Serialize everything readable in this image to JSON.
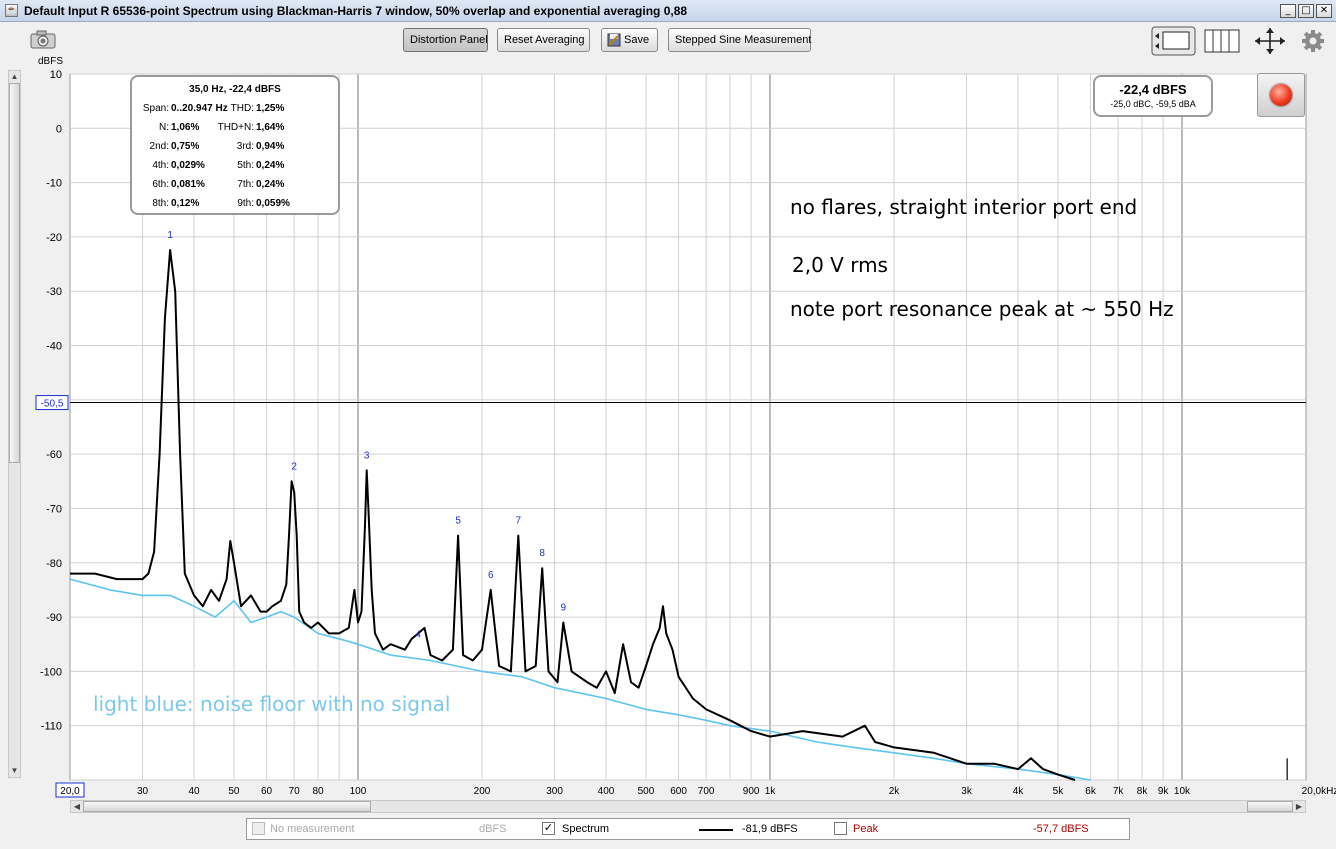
{
  "window": {
    "title": "Default Input R 65536-point Spectrum using Blackman-Harris 7 window, 50% overlap and exponential averaging 0,88",
    "minimize": "_",
    "maximize": "□",
    "close": "✕"
  },
  "toolbar": {
    "distortion_panel": "Distortion Panel",
    "reset_averaging": "Reset Averaging",
    "save": "Save",
    "stepped_sine": "Stepped Sine Measurement"
  },
  "icons": {
    "camera": "camera-icon",
    "save": "save-icon",
    "view_layout": "view-layout-icon",
    "columns": "columns-icon",
    "fit": "fit-arrows-icon",
    "settings": "gear-icon",
    "record": "record-icon"
  },
  "info_box": {
    "header": "35,0 Hz, -22,4 dBFS",
    "rows": [
      {
        "l1": "Span:",
        "v1": "0..20.947 Hz",
        "l2": "THD:",
        "v2": "1,25%"
      },
      {
        "l1": "N:",
        "v1": "1,06%",
        "l2": "THD+N:",
        "v2": "1,64%"
      },
      {
        "l1": "2nd:",
        "v1": "0,75%",
        "l2": "3rd:",
        "v2": "0,94%"
      },
      {
        "l1": "4th:",
        "v1": "0,029%",
        "l2": "5th:",
        "v2": "0,24%"
      },
      {
        "l1": "6th:",
        "v1": "0,081%",
        "l2": "7th:",
        "v2": "0,24%"
      },
      {
        "l1": "8th:",
        "v1": "0,12%",
        "l2": "9th:",
        "v2": "0,059%"
      }
    ]
  },
  "level_box": {
    "main": "-22,4 dBFS",
    "sub": "-25,0 dBC, -59,5 dBA"
  },
  "annotations": {
    "line1": "no flares, straight interior port end",
    "line2": "2,0 V rms",
    "line3": "note port resonance peak at ~ 550 Hz",
    "noise": "light blue: noise floor with no signal"
  },
  "legend": {
    "no_measurement": "No measurement",
    "no_measurement_unit": "dBFS",
    "spectrum": "Spectrum",
    "spectrum_checked": "✓",
    "spectrum_value": "-81,9 dBFS",
    "peak": "Peak",
    "peak_value": "-57,7 dBFS"
  },
  "chart_data": {
    "type": "line",
    "ylabel": "dBFS",
    "xscale": "log",
    "xlim": [
      20,
      20000
    ],
    "ylim": [
      -120,
      10
    ],
    "grid": true,
    "cursor_y": -50.5,
    "cursor_y_label": "-50,5",
    "x_start_label": "20,0",
    "x_end_label": "20,0kHz",
    "y_ticks": [
      10,
      0,
      -10,
      -20,
      -30,
      -40,
      -60,
      -70,
      -80,
      -90,
      -100,
      -110
    ],
    "x_ticks": [
      {
        "v": 30,
        "label": "30"
      },
      {
        "v": 40,
        "label": "40"
      },
      {
        "v": 50,
        "label": "50"
      },
      {
        "v": 60,
        "label": "60"
      },
      {
        "v": 70,
        "label": "70"
      },
      {
        "v": 80,
        "label": "80"
      },
      {
        "v": 100,
        "label": "100"
      },
      {
        "v": 200,
        "label": "200"
      },
      {
        "v": 300,
        "label": "300"
      },
      {
        "v": 400,
        "label": "400"
      },
      {
        "v": 500,
        "label": "500"
      },
      {
        "v": 600,
        "label": "600"
      },
      {
        "v": 700,
        "label": "700"
      },
      {
        "v": 900,
        "label": "900"
      },
      {
        "v": 1000,
        "label": "1k"
      },
      {
        "v": 2000,
        "label": "2k"
      },
      {
        "v": 3000,
        "label": "3k"
      },
      {
        "v": 4000,
        "label": "4k"
      },
      {
        "v": 5000,
        "label": "5k"
      },
      {
        "v": 6000,
        "label": "6k"
      },
      {
        "v": 7000,
        "label": "7k"
      },
      {
        "v": 8000,
        "label": "8k"
      },
      {
        "v": 9000,
        "label": "9k"
      },
      {
        "v": 10000,
        "label": "10k"
      }
    ],
    "harmonic_markers": [
      {
        "label": "1",
        "x": 35,
        "y": -22.4
      },
      {
        "label": "2",
        "x": 70,
        "y": -65
      },
      {
        "label": "3",
        "x": 105,
        "y": -63
      },
      {
        "label": "4",
        "x": 140,
        "y": -96
      },
      {
        "label": "5",
        "x": 175,
        "y": -75
      },
      {
        "label": "6",
        "x": 210,
        "y": -85
      },
      {
        "label": "7",
        "x": 245,
        "y": -75
      },
      {
        "label": "8",
        "x": 280,
        "y": -81
      },
      {
        "label": "9",
        "x": 315,
        "y": -91
      }
    ],
    "series": [
      {
        "color": "#000000",
        "x": [
          20,
          23,
          26,
          28,
          30,
          31,
          32,
          33,
          34,
          35,
          36,
          37,
          38,
          40,
          42,
          44,
          46,
          48,
          49,
          50,
          52,
          55,
          58,
          60,
          62,
          65,
          67,
          68,
          69,
          70,
          71,
          72,
          74,
          77,
          80,
          85,
          90,
          95,
          98,
          100,
          102,
          104,
          105,
          106,
          108,
          110,
          115,
          120,
          130,
          135,
          140,
          145,
          150,
          160,
          170,
          175,
          180,
          190,
          200,
          210,
          220,
          235,
          245,
          255,
          270,
          280,
          290,
          305,
          315,
          330,
          360,
          380,
          400,
          420,
          440,
          460,
          480,
          500,
          520,
          540,
          550,
          560,
          580,
          600,
          650,
          700,
          800,
          900,
          1000,
          1200,
          1500,
          1700,
          1800,
          2000,
          2500,
          3000,
          3500,
          4000,
          4300,
          4600,
          5000,
          5500
        ],
        "y": [
          -82,
          -82,
          -83,
          -83,
          -83,
          -82,
          -78,
          -60,
          -35,
          -22.4,
          -30,
          -60,
          -82,
          -86,
          -88,
          -85,
          -87,
          -83,
          -76,
          -80,
          -88,
          -86,
          -89,
          -89,
          -88,
          -87,
          -84,
          -75,
          -65,
          -67,
          -75,
          -89,
          -91,
          -92,
          -91,
          -93,
          -93,
          -92,
          -85,
          -91,
          -89,
          -73,
          -63,
          -70,
          -85,
          -93,
          -96,
          -95,
          -96,
          -94,
          -93,
          -92,
          -97,
          -98,
          -96,
          -75,
          -97,
          -98,
          -96,
          -85,
          -99,
          -100,
          -75,
          -100,
          -99,
          -81,
          -100,
          -102,
          -91,
          -100,
          -102,
          -103,
          -100,
          -104,
          -95,
          -102,
          -103,
          -99,
          -95,
          -92,
          -88,
          -93,
          -96,
          -101,
          -105,
          -107,
          -109,
          -111,
          -112,
          -111,
          -112,
          -110,
          -113,
          -114,
          -115,
          -117,
          -117,
          -118,
          -116,
          -118,
          -119,
          -120
        ]
      },
      {
        "color": "#5bc4f1",
        "x": [
          20,
          25,
          30,
          35,
          40,
          45,
          50,
          55,
          60,
          65,
          70,
          80,
          90,
          100,
          120,
          150,
          200,
          250,
          300,
          400,
          500,
          600,
          700,
          800,
          1000,
          1300,
          1600,
          2000,
          2500,
          3000,
          4000,
          5000,
          6000
        ],
        "y": [
          -83,
          -85,
          -86,
          -86,
          -88,
          -90,
          -87,
          -91,
          -90,
          -89,
          -90,
          -93,
          -94,
          -95,
          -97,
          -98,
          -100,
          -101,
          -103,
          -105,
          -107,
          -108,
          -109,
          -110,
          -111,
          -113,
          -114,
          -115,
          -116,
          -117,
          -118,
          -119,
          -120
        ]
      }
    ]
  }
}
